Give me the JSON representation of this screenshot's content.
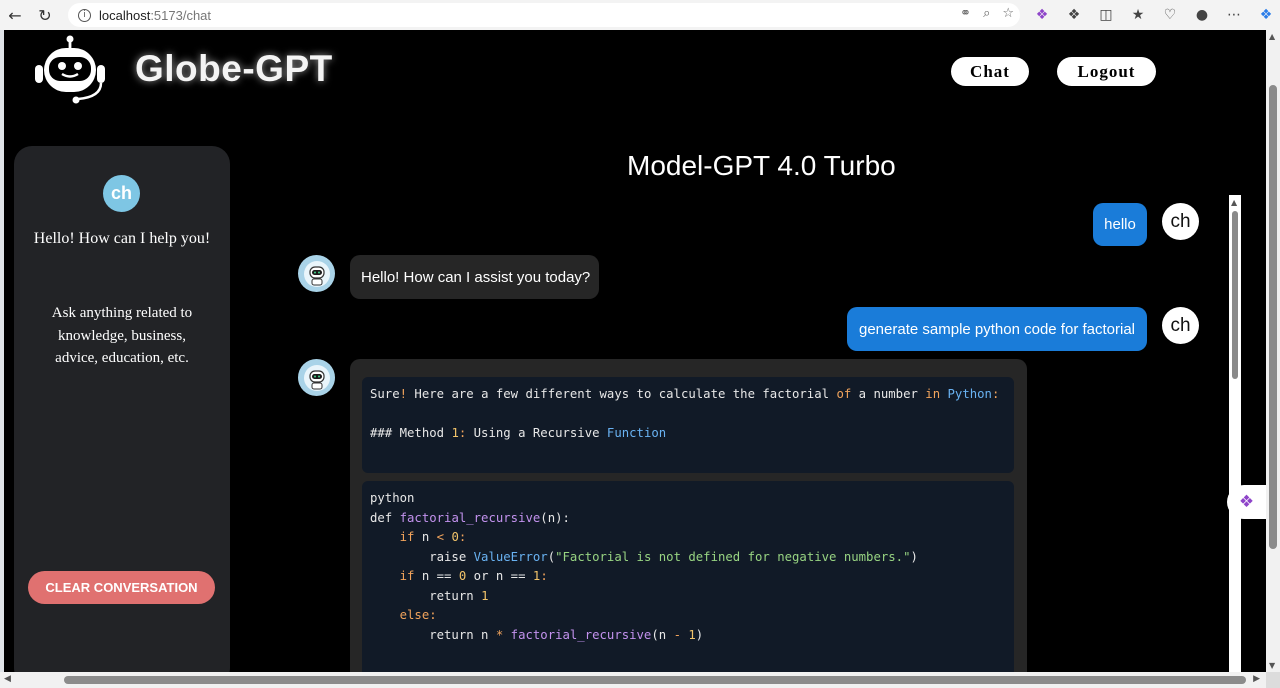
{
  "browser": {
    "url_host": "localhost",
    "url_path": ":5173/chat"
  },
  "header": {
    "brand": "Globe-GPT",
    "nav": {
      "chat": "Chat",
      "logout": "Logout"
    }
  },
  "sidebar": {
    "avatar_initials": "ch",
    "greeting": "Hello! How can I help you!",
    "info": "Ask anything related to knowledge, business, advice, education, etc.",
    "clear_button": "CLEAR CONVERSATION"
  },
  "chat": {
    "title": "Model-GPT 4.0 Turbo",
    "user_avatar": "ch",
    "messages": [
      {
        "role": "user",
        "text": "hello"
      },
      {
        "role": "bot",
        "text": "Hello! How can I assist you today?"
      },
      {
        "role": "user",
        "text": "generate sample python code for factorial"
      }
    ],
    "bot_reply": {
      "intro": [
        "Sure",
        "!",
        " Here are a few different ways to calculate the factorial ",
        "of",
        " a number ",
        "in",
        " ",
        "Python",
        ":"
      ],
      "heading": [
        "### Method ",
        "1",
        ":",
        " Using a Recursive ",
        "Function"
      ],
      "code": {
        "line1": "python",
        "line2": [
          "def ",
          "factorial_recursive",
          "(n):"
        ],
        "line3": [
          "    ",
          "if",
          " n ",
          "<",
          " ",
          "0",
          ":"
        ],
        "line4": [
          "        raise ",
          "ValueError",
          "(",
          "\"Factorial is not defined for negative numbers.\"",
          ")"
        ],
        "line5": [
          "    ",
          "if",
          " n == ",
          "0",
          " or n == ",
          "1",
          ":"
        ],
        "line6": [
          "        return ",
          "1"
        ],
        "line7": [
          "    ",
          "else",
          ":"
        ],
        "line8": [
          "        return n ",
          "*",
          " ",
          "factorial_recursive",
          "(n ",
          "-",
          " ",
          "1",
          ")"
        ]
      }
    }
  },
  "colors": {
    "user_bubble": "#1a7cd9",
    "bot_bubble": "#262626",
    "clear_button": "#e07170",
    "sidebar_bg": "#222326"
  }
}
